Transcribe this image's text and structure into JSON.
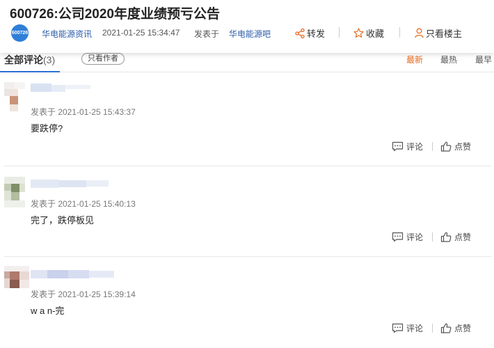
{
  "post": {
    "title": "600726:公司2020年度业绩预亏公告",
    "logo_text": "600726",
    "author": "华电能源资讯",
    "time": "2021-01-25 15:34:47",
    "posted_in_prefix": "发表于",
    "posted_in_bar": "华电能源吧",
    "actions": {
      "share": "转发",
      "favorite": "收藏",
      "owner_only": "只看楼主"
    }
  },
  "tabs": {
    "all_label": "全部评论",
    "all_count": "(3)",
    "author_only": "只看作者",
    "sort": [
      "最新",
      "最热",
      "最早"
    ],
    "active_sort": "最新",
    "active_color": "#e86b1f",
    "accent_color": "#2a6fd6"
  },
  "comments": [
    {
      "time": "发表于 2021-01-25 15:43:37",
      "text": "要跌停?",
      "reply_label": "评论",
      "like_label": "点赞"
    },
    {
      "time": "发表于 2021-01-25 15:40:13",
      "text": "完了，跌停板见",
      "reply_label": "评论",
      "like_label": "点赞"
    },
    {
      "time": "发表于 2021-01-25 15:39:14",
      "text": "w a n-完",
      "reply_label": "评论",
      "like_label": "点赞"
    }
  ]
}
